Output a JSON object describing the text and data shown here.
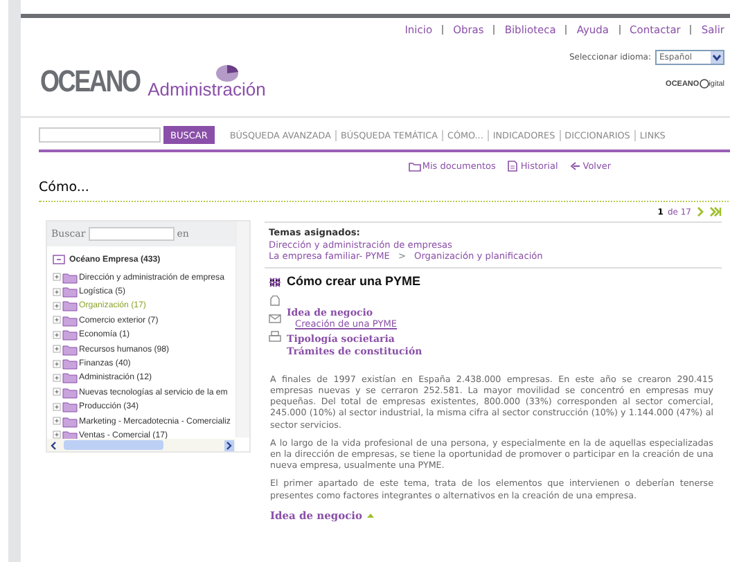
{
  "top_links": [
    "Inicio",
    "Obras",
    "Biblioteca",
    "Ayuda",
    "Contactar",
    "Salir"
  ],
  "logo": {
    "brand": "OCEANO",
    "product": "Administración"
  },
  "language": {
    "label": "Seleccionar idioma:",
    "value": "Español"
  },
  "partner_logo": {
    "brand": "OCEANO",
    "suffix": "igital"
  },
  "search": {
    "button": "BUSCAR"
  },
  "nav": [
    "BÚSQUEDA AVANZADA",
    "BÚSQUEDA TEMÁTICA",
    "CÓMO...",
    "INDICADORES",
    "DICCIONARIOS",
    "LINKS"
  ],
  "toolbar": [
    {
      "kind": "folder",
      "label": "Mis documentos"
    },
    {
      "kind": "document",
      "label": "Historial"
    },
    {
      "kind": "back",
      "label": "Volver"
    }
  ],
  "section_title": "Cómo...",
  "tree_panel": {
    "search_label": "Buscar",
    "search_scope": "en",
    "root": {
      "label": "Océano Empresa (433)",
      "expanded": true,
      "children": [
        {
          "label": "Dirección y administración de empresa",
          "selected": false
        },
        {
          "label": "Logística (5)",
          "selected": false
        },
        {
          "label": "Organización (17)",
          "selected": true
        },
        {
          "label": "Comercio exterior (7)",
          "selected": false
        },
        {
          "label": "Economía (1)",
          "selected": false
        },
        {
          "label": "Recursos humanos (98)",
          "selected": false
        },
        {
          "label": "Finanzas (40)",
          "selected": false
        },
        {
          "label": "Administración (12)",
          "selected": false
        },
        {
          "label": "Nuevas tecnologías al servicio de la em",
          "selected": false
        },
        {
          "label": "Producción (34)",
          "selected": false
        },
        {
          "label": "Marketing - Mercadotecnia - Comercializ",
          "selected": false
        },
        {
          "label": "Ventas - Comercial (17)",
          "selected": false
        }
      ]
    }
  },
  "article": {
    "pager": {
      "current": "1",
      "total": "de 17"
    },
    "topics_label": "Temas asignados:",
    "topics": [
      "Dirección y administración de empresas"
    ],
    "breadcrumb": [
      "La empresa familiar- PYME",
      "Organización y planificación"
    ],
    "breadcrumb_separator": ">",
    "title": "Cómo crear una PYME",
    "actions": [
      {
        "kind": "close"
      },
      {
        "kind": "save"
      },
      {
        "kind": "mail"
      },
      {
        "kind": "print"
      }
    ],
    "outline": [
      {
        "label": "Idea de negocio",
        "children": [
          {
            "label": "Creación de una PYME"
          }
        ]
      },
      {
        "label": "Tipología societaria"
      },
      {
        "label": "Trámites de constitución"
      }
    ],
    "paragraphs": [
      "A finales de 1997 existían en España 2.438.000 empresas. En este año se crearon 290.415 empresas nuevas y se cerraron 252.581. La mayor movilidad se concentró en empresas muy pequeñas. Del total de empresas existentes, 800.000 (33%) corresponden al sector comercial, 245.000 (10%) al sector industrial, la misma cifra al sector construcción (10%) y 1.144.000 (47%) al sector servicios.",
      "A lo largo de la vida profesional de una persona, y especialmente en la de aquellas especializadas en la dirección de empresas, se tiene la oportunidad de promover o participar en la creación de una nueva empresa, usualmente una PYME.",
      "El primer apartado de este tema, trata de los elementos que intervienen o deberían tenerse presentes como factores integrantes o alternativos en la creación de una empresa."
    ],
    "section_heading": "Idea de negocio"
  }
}
